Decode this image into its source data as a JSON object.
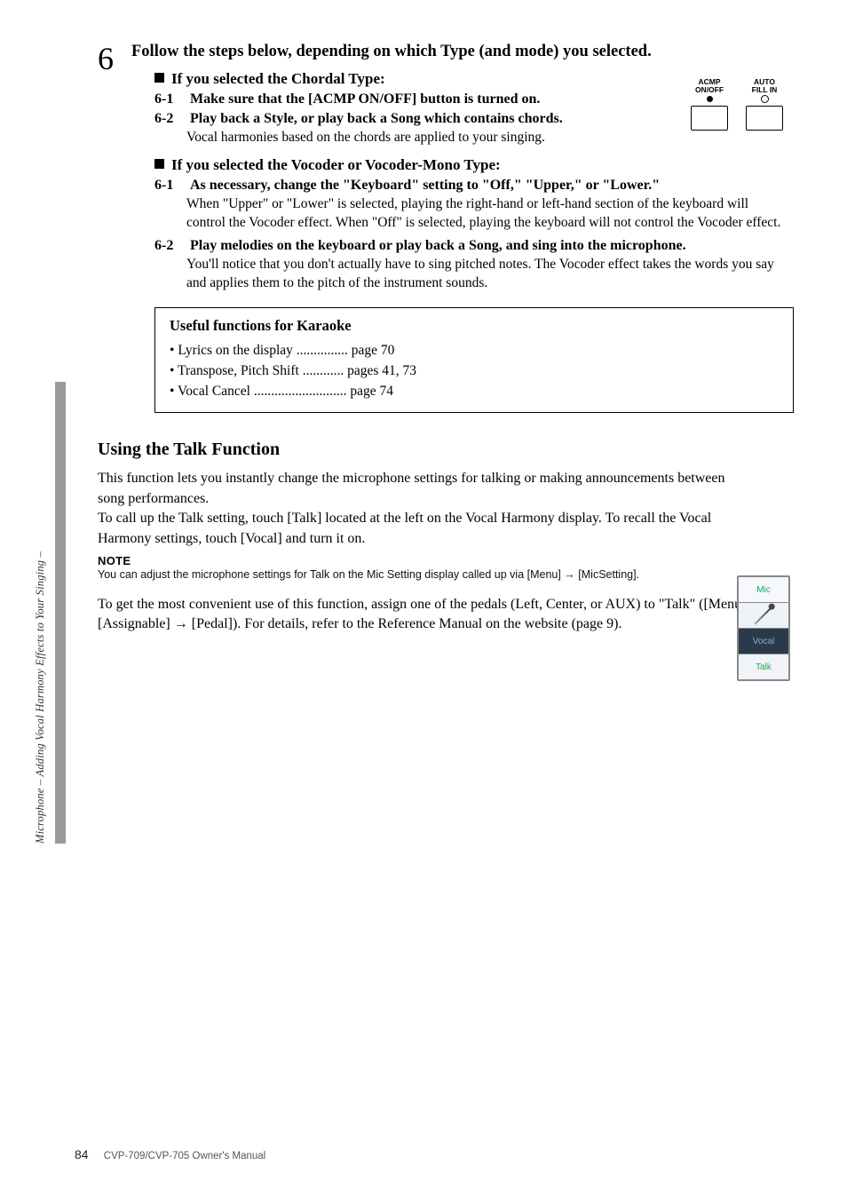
{
  "side_tab": "Microphone – Adding Vocal Harmony Effects to Your Singing –",
  "step": {
    "num": "6",
    "title": "Follow the steps below, depending on which Type (and mode) you selected.",
    "chordal": {
      "heading": "If you selected the Chordal Type:",
      "item1_label": "6-1",
      "item1_title": "Make sure that the [ACMP ON/OFF] button is turned on.",
      "item2_label": "6-2",
      "item2_title": "Play back a Style, or play back a Song which contains chords.",
      "item2_desc": "Vocal harmonies based on the chords are applied to your singing."
    },
    "vocoder": {
      "heading": "If you selected the Vocoder or Vocoder-Mono Type:",
      "item1_label": "6-1",
      "item1_title": "As necessary, change the \"Keyboard\" setting to \"Off,\" \"Upper,\" or \"Lower.\"",
      "item1_desc": "When \"Upper\" or \"Lower\" is selected, playing the right-hand or left-hand section of the keyboard will control the Vocoder effect. When \"Off\" is selected, playing the keyboard will not control the Vocoder effect.",
      "item2_label": "6-2",
      "item2_title": "Play melodies on the keyboard or play back a Song, and sing into the microphone.",
      "item2_desc": "You'll notice that you don't actually have to sing pitched notes. The Vocoder effect takes the words you say and applies them to the pitch of the instrument sounds."
    }
  },
  "buttons": {
    "acmp": "ACMP\nON/OFF",
    "auto": "AUTO\nFILL IN"
  },
  "karaoke_box": {
    "header": "Useful functions for Karaoke",
    "line1": "Lyrics on the display ............... page 70",
    "line2": "Transpose, Pitch Shift ............ pages 41, 73",
    "line3": "Vocal Cancel ........................... page 74"
  },
  "talk": {
    "heading": "Using the Talk Function",
    "p1": "This function lets you instantly change the microphone settings for talking or making announcements between song performances.",
    "p2": "To call up the Talk setting, touch [Talk] located at the left on the Vocal Harmony display. To recall the Vocal Harmony settings, touch [Vocal] and turn it on.",
    "note_label": "NOTE",
    "note_text": "You can adjust the microphone settings for Talk on the Mic Setting display called up via [Menu] → [MicSetting].",
    "p3": "To get the most convenient use of this function, assign one of the pedals (Left, Center, or AUX) to \"Talk\" ([Menu] → [Assignable] → [Pedal]). For details, refer to the Reference Manual on the website (page 9)."
  },
  "mic_panel": {
    "mic": "Mic",
    "vocal": "Vocal",
    "talk": "Talk"
  },
  "footer": {
    "page": "84",
    "model": "CVP-709/CVP-705 Owner's Manual"
  }
}
